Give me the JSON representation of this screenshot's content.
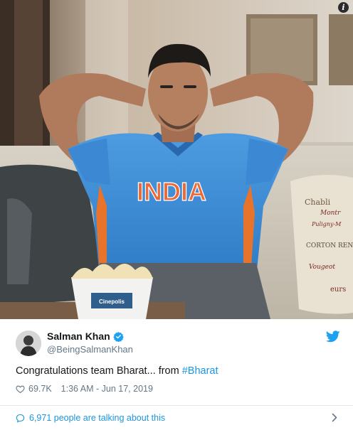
{
  "media": {
    "jersey_text": "INDIA",
    "cushion_text": [
      "Chabli",
      "Montr",
      "Puligny-M",
      "CORTON RENAR",
      "Vougeot",
      "eurs"
    ],
    "popcorn_box_text": [
      "Cinepolis"
    ]
  },
  "tweet": {
    "user_name": "Salman Khan",
    "user_handle": "@BeingSalmanKhan",
    "text_prefix": "Congratulations team Bharat... from ",
    "hashtag": "#Bharat",
    "like_count": "69.7K",
    "timestamp": "1:36 AM - Jun 17, 2019",
    "talking_text": "6,971 people are talking about this"
  },
  "colors": {
    "link": "#1b95e0",
    "jersey": "#3f8ed6",
    "meta": "#657786"
  },
  "icons": [
    "info-icon",
    "verified-icon",
    "twitter-bird-icon",
    "heart-icon",
    "comment-icon",
    "chevron-right-icon"
  ]
}
